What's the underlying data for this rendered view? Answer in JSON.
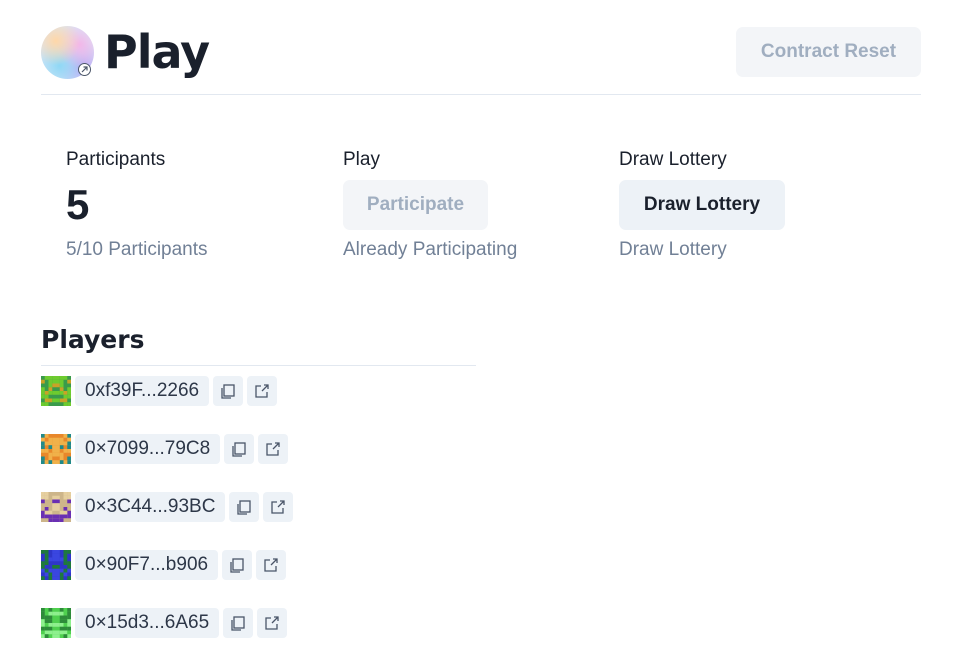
{
  "header": {
    "title": "Play",
    "reset_label": "Contract Reset"
  },
  "stats": {
    "participants": {
      "label": "Participants",
      "count": "5",
      "help": "5/10 Participants"
    },
    "play": {
      "label": "Play",
      "button_label": "Participate",
      "help": "Already Participating"
    },
    "draw": {
      "label": "Draw Lottery",
      "button_label": "Draw Lottery",
      "help": "Draw Lottery"
    }
  },
  "players": {
    "title": "Players",
    "items": [
      {
        "address": "0xf39F...2266",
        "avatar_colors": [
          "#3a9b4b",
          "#c9a227",
          "#6ecb2f"
        ]
      },
      {
        "address": "0×7099...79C8",
        "avatar_colors": [
          "#e8872a",
          "#1f8a8a",
          "#f0b14a"
        ]
      },
      {
        "address": "0×3C44...93BC",
        "avatar_colors": [
          "#cdb58a",
          "#6a2fb3",
          "#e6cf9f"
        ]
      },
      {
        "address": "0×90F7...b906",
        "avatar_colors": [
          "#2e36c8",
          "#1e7a3a",
          "#3a46e0"
        ]
      },
      {
        "address": "0×15d3...6A65",
        "avatar_colors": [
          "#4fd04f",
          "#2e8b3a",
          "#8ef08e"
        ]
      }
    ]
  },
  "icons": {
    "copy": "copy-icon",
    "external": "external-link-icon"
  }
}
